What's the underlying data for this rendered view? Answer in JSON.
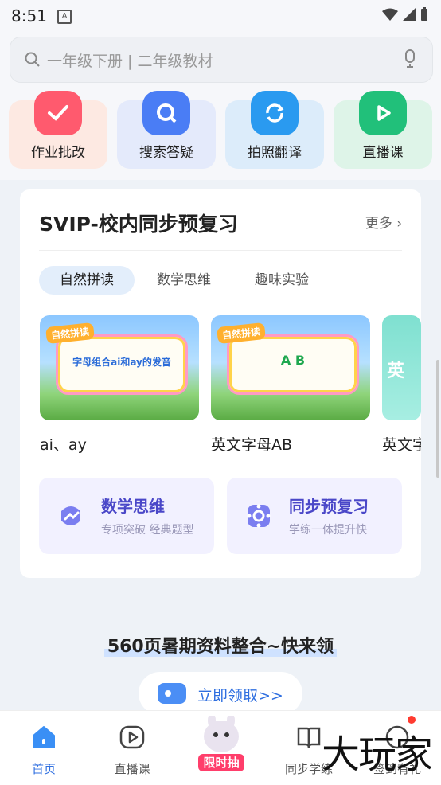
{
  "status_bar": {
    "time": "8:51",
    "notif_icon": "A"
  },
  "search": {
    "placeholder": "一年级下册 | 二年级教材"
  },
  "quick_actions": [
    {
      "label": "作业批改",
      "icon": "check-icon",
      "color": "#ff5a6e",
      "bg": "#fde9e2"
    },
    {
      "label": "搜索答疑",
      "icon": "search-q-icon",
      "color": "#4a7df5",
      "bg": "#e4eafb"
    },
    {
      "label": "拍照翻译",
      "icon": "translate-icon",
      "color": "#2a9af0",
      "bg": "#dcecfa"
    },
    {
      "label": "直播课",
      "icon": "play-icon",
      "color": "#21c07a",
      "bg": "#def4e8"
    }
  ],
  "section": {
    "title": "SVIP-校内同步预复习",
    "more": "更多",
    "tabs": [
      "自然拼读",
      "数学思维",
      "趣味实验"
    ],
    "active_tab": 0,
    "videos": [
      {
        "caption": "ai、ay",
        "board_text": "字母组合ai和ay的发音",
        "tag": "自然拼读"
      },
      {
        "caption": "英文字母AB",
        "board_text": "A B",
        "tag": "自然拼读"
      },
      {
        "caption": "英文字",
        "board_text": "英"
      }
    ],
    "features": [
      {
        "title": "数学思维",
        "subtitle": "专项突破 经典题型"
      },
      {
        "title": "同步预复习",
        "subtitle": "学练一体提升快"
      }
    ]
  },
  "promo": {
    "title": "560页暑期资料整合~快来领",
    "button": "立即领取>>"
  },
  "tabbar": {
    "items": [
      "首页",
      "直播课",
      "限时抽",
      "同步学练",
      "签到有礼"
    ],
    "active": 0
  },
  "watermark": "大玩家"
}
